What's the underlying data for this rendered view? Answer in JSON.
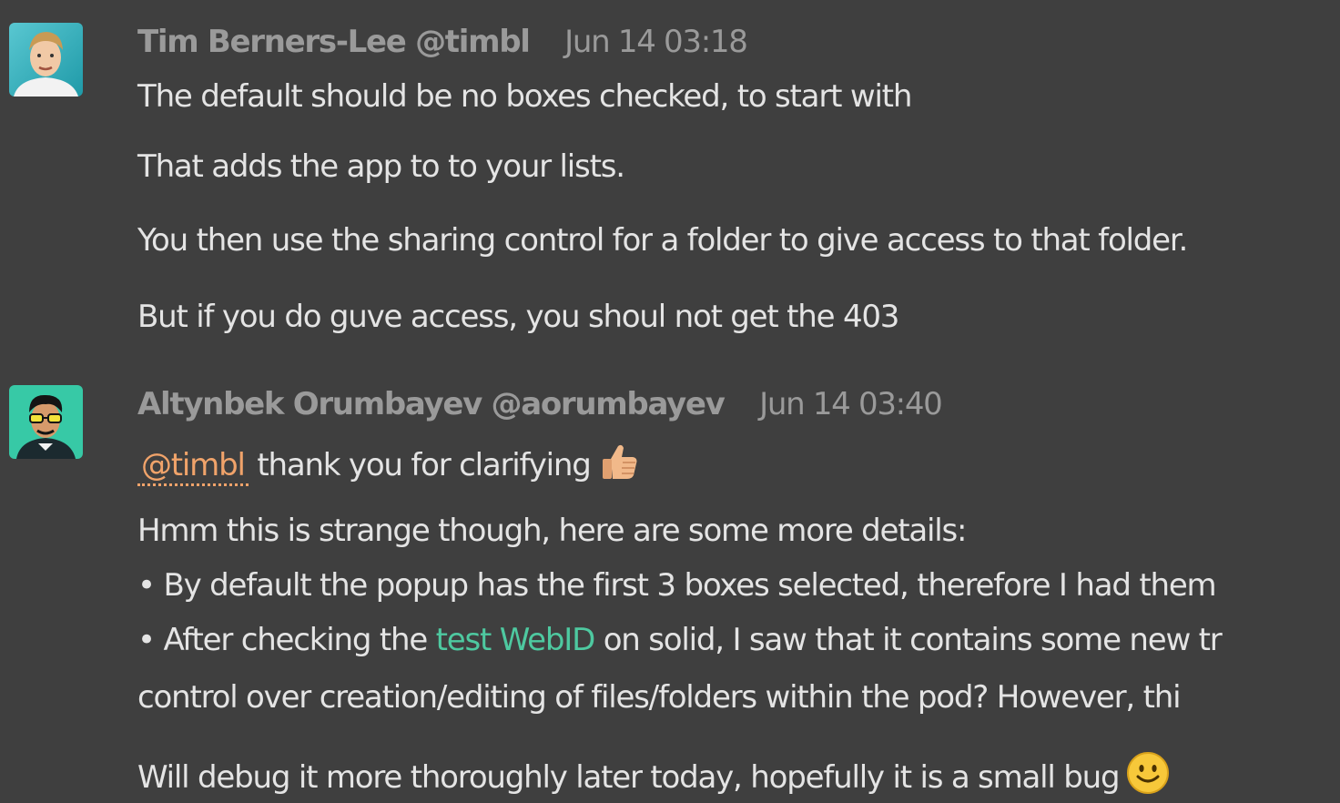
{
  "messages": [
    {
      "author": "Tim Berners-Lee",
      "handle": "@timbl",
      "time": "Jun 14 03:18",
      "lines": [
        "The default should be no boxes checked, to start with",
        "That adds the app to to your lists.",
        "You then use the sharing control for a folder to give access to that folder.",
        "But if you do guve access, you shoul not get the 403"
      ]
    },
    {
      "author": "Altynbek Orumbayev",
      "handle": "@aorumbayev",
      "time": "Jun 14 03:40",
      "mention": "@timbl",
      "mention_text": " thank you for clarifying",
      "intro": "Hmm this is strange though, here are some more details:",
      "bullet1": "• By default the popup has the first 3 boxes selected, therefore I had them",
      "bullet2_prefix": "• After checking the ",
      "bullet2_link": "test WebID",
      "bullet2_suffix": " on solid, I saw that it contains some new tr",
      "bullet2_cont": "control over creation/editing of files/folders within the pod? However, thi",
      "closing": "Will debug it more thoroughly later today, hopefully it is a small bug"
    }
  ],
  "colors": {
    "background": "#3f3f3f",
    "mention": "#f0a36a",
    "link": "#4ec9a0",
    "meta": "#9a9a9a"
  },
  "icons": [
    "thumbs-up-emoji",
    "smiley-emoji"
  ]
}
